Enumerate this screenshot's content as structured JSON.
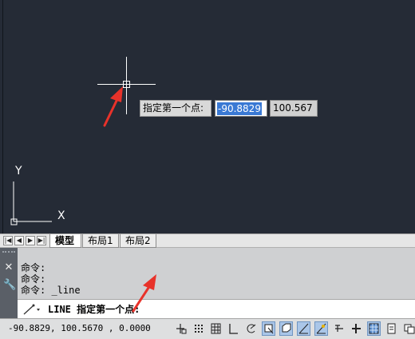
{
  "canvas": {
    "tooltip_label": "指定第一个点:",
    "x_value": "-90.8829",
    "y_value": "100.567",
    "ucs_x": "X",
    "ucs_y": "Y"
  },
  "tabs": {
    "items": [
      {
        "label": "模型",
        "active": true
      },
      {
        "label": "布局1",
        "active": false
      },
      {
        "label": "布局2",
        "active": false
      }
    ]
  },
  "command": {
    "history": [
      "命令:",
      "命令:",
      "命令: _line"
    ],
    "prompt": "LINE 指定第一个点:"
  },
  "status": {
    "coords": "-90.8829,  100.5670 , 0.0000"
  },
  "colors": {
    "canvas_bg": "#252b36",
    "highlight": "#3a79d4",
    "arrow": "#e8322a"
  }
}
